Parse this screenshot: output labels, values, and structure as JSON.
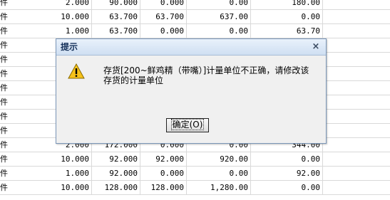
{
  "table": {
    "rows": [
      {
        "mark": "件",
        "qty": "2.000",
        "price": "90.000",
        "c3": "0.000",
        "c4": "0.00",
        "c5": "180.00"
      },
      {
        "mark": "件",
        "qty": "10.000",
        "price": "63.700",
        "c3": "63.700",
        "c4": "637.00",
        "c5": "0.00"
      },
      {
        "mark": "件",
        "qty": "1.000",
        "price": "63.700",
        "c3": "0.000",
        "c4": "0.00",
        "c5": "63.70"
      },
      {
        "mark": "件",
        "qty": "",
        "price": "",
        "c3": "",
        "c4": "",
        "c5": ""
      },
      {
        "mark": "件",
        "qty": "",
        "price": "",
        "c3": "",
        "c4": "",
        "c5": ""
      },
      {
        "mark": "件",
        "qty": "",
        "price": "",
        "c3": "",
        "c4": "",
        "c5": ""
      },
      {
        "mark": "件",
        "qty": "",
        "price": "",
        "c3": "",
        "c4": "",
        "c5": ""
      },
      {
        "mark": "件",
        "qty": "",
        "price": "",
        "c3": "",
        "c4": "",
        "c5": ""
      },
      {
        "mark": "件",
        "qty": "",
        "price": "",
        "c3": "",
        "c4": "",
        "c5": ""
      },
      {
        "mark": "件",
        "qty": "",
        "price": "",
        "c3": "",
        "c4": "",
        "c5": ""
      },
      {
        "mark": "件",
        "qty": "2.000",
        "price": "172.000",
        "c3": "0.000",
        "c4": "0.00",
        "c5": "344.00"
      },
      {
        "mark": "件",
        "qty": "10.000",
        "price": "92.000",
        "c3": "92.000",
        "c4": "920.00",
        "c5": "0.00"
      },
      {
        "mark": "件",
        "qty": "1.000",
        "price": "92.000",
        "c3": "0.000",
        "c4": "0.00",
        "c5": "92.00"
      },
      {
        "mark": "件",
        "qty": "10.000",
        "price": "128.000",
        "c3": "128.000",
        "c4": "1,280.00",
        "c5": "0.00"
      }
    ]
  },
  "dialog": {
    "title": "提示",
    "close_glyph": "×",
    "icon": "warning-icon",
    "message_line1": "存货[200~鲜鸡精（带嘴）]计量单位不正确，请修改该",
    "message_line2": "存货的计量单位",
    "ok_label": "确定(O)"
  },
  "colors": {
    "grid_line": "#d9d9d9",
    "dialog_border": "#7a96b8",
    "title_text": "#14305a",
    "warning_fill": "#f6c21a"
  }
}
